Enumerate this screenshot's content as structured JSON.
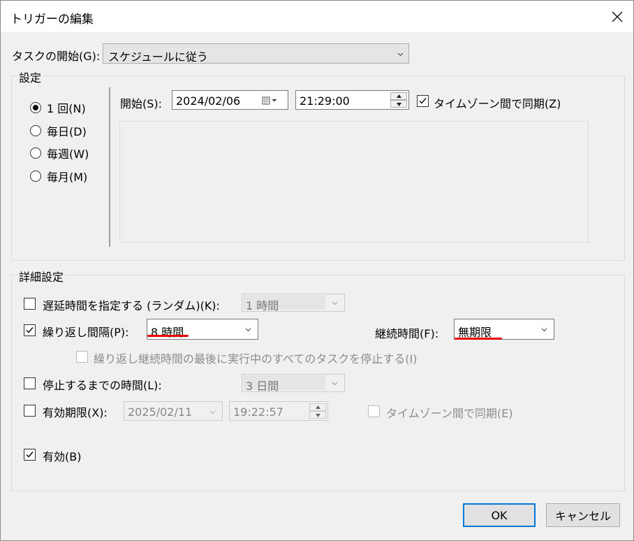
{
  "window": {
    "title": "トリガーの編集"
  },
  "task_start": {
    "label": "タスクの開始(G):",
    "value": "スケジュールに従う"
  },
  "settings": {
    "legend": "設定",
    "radios": [
      {
        "label": "1 回(N)",
        "selected": true
      },
      {
        "label": "毎日(D)",
        "selected": false
      },
      {
        "label": "毎週(W)",
        "selected": false
      },
      {
        "label": "毎月(M)",
        "selected": false
      }
    ],
    "start_label": "開始(S):",
    "start_date": "2024/02/06",
    "start_time": "21:29:00",
    "sync_timezone_label": "タイムゾーン間で同期(Z)",
    "sync_timezone_checked": true
  },
  "advanced": {
    "legend": "詳細設定",
    "delay": {
      "label": "遅延時間を指定する (ランダム)(K):",
      "checked": false,
      "value": "1 時間"
    },
    "repeat": {
      "label": "繰り返し間隔(P):",
      "checked": true,
      "value": "8 時間"
    },
    "duration": {
      "label": "継続時間(F):",
      "value": "無期限"
    },
    "stop_all": {
      "label": "繰り返し継続時間の最後に実行中のすべてのタスクを停止する(I)",
      "checked": false
    },
    "stop_after": {
      "label": "停止するまでの時間(L):",
      "checked": false,
      "value": "3 日間"
    },
    "expire": {
      "label": "有効期限(X):",
      "checked": false,
      "date": "2025/02/11",
      "time": "19:22:57"
    },
    "expire_sync": {
      "label": "タイムゾーン間で同期(E)",
      "checked": false
    },
    "enabled": {
      "label": "有効(B)",
      "checked": true
    }
  },
  "buttons": {
    "ok": "OK",
    "cancel": "キャンセル"
  },
  "colors": {
    "accent": "#0078d7",
    "annotation": "#e60000"
  }
}
